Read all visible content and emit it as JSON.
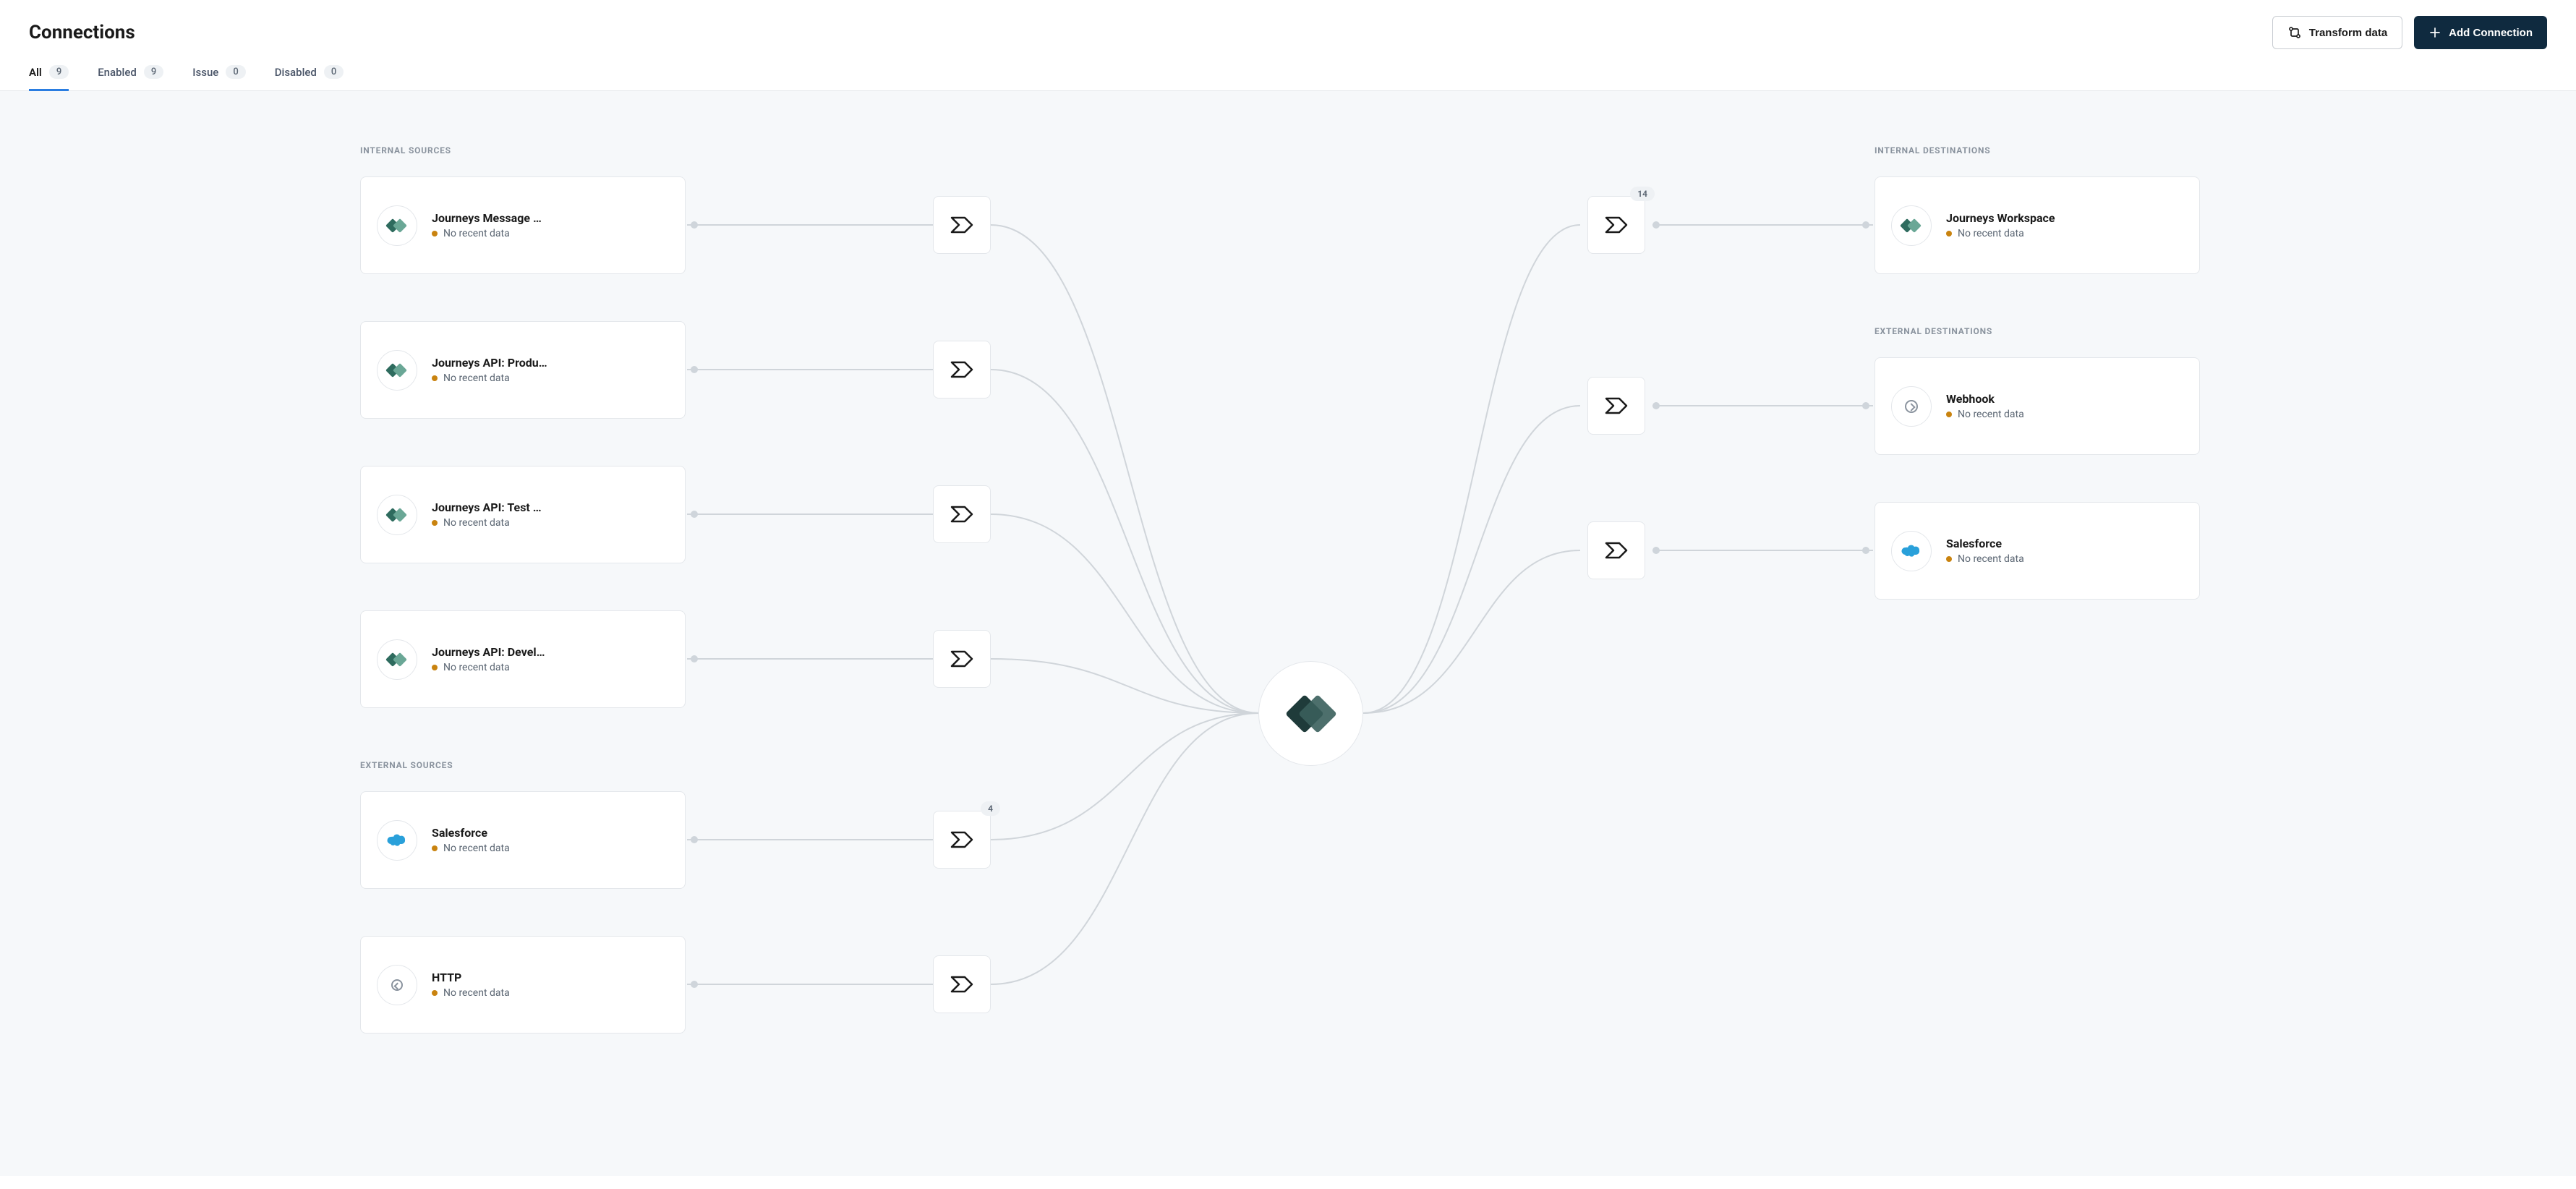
{
  "header": {
    "title": "Connections",
    "transform_label": "Transform data",
    "add_label": "Add Connection"
  },
  "tabs": [
    {
      "label": "All",
      "count": "9",
      "active": true
    },
    {
      "label": "Enabled",
      "count": "9",
      "active": false
    },
    {
      "label": "Issue",
      "count": "0",
      "active": false
    },
    {
      "label": "Disabled",
      "count": "0",
      "active": false
    }
  ],
  "sections": {
    "internal_sources": "INTERNAL SOURCES",
    "external_sources": "EXTERNAL SOURCES",
    "internal_destinations": "INTERNAL DESTINATIONS",
    "external_destinations": "EXTERNAL DESTINATIONS"
  },
  "status_text": "No recent data",
  "sources": {
    "internal": [
      {
        "title": "Journeys Message …",
        "icon": "journeys"
      },
      {
        "title": "Journeys API: Produ…",
        "icon": "journeys"
      },
      {
        "title": "Journeys API: Test …",
        "icon": "journeys"
      },
      {
        "title": "Journeys API: Devel…",
        "icon": "journeys"
      }
    ],
    "external": [
      {
        "title": "Salesforce",
        "icon": "salesforce"
      },
      {
        "title": "HTTP",
        "icon": "http"
      }
    ]
  },
  "destinations": {
    "internal": [
      {
        "title": "Journeys Workspace",
        "icon": "journeys"
      }
    ],
    "external": [
      {
        "title": "Webhook",
        "icon": "webhook"
      },
      {
        "title": "Salesforce",
        "icon": "salesforce"
      }
    ]
  },
  "badges": {
    "src_salesforce": "4",
    "dest_top": "14"
  }
}
